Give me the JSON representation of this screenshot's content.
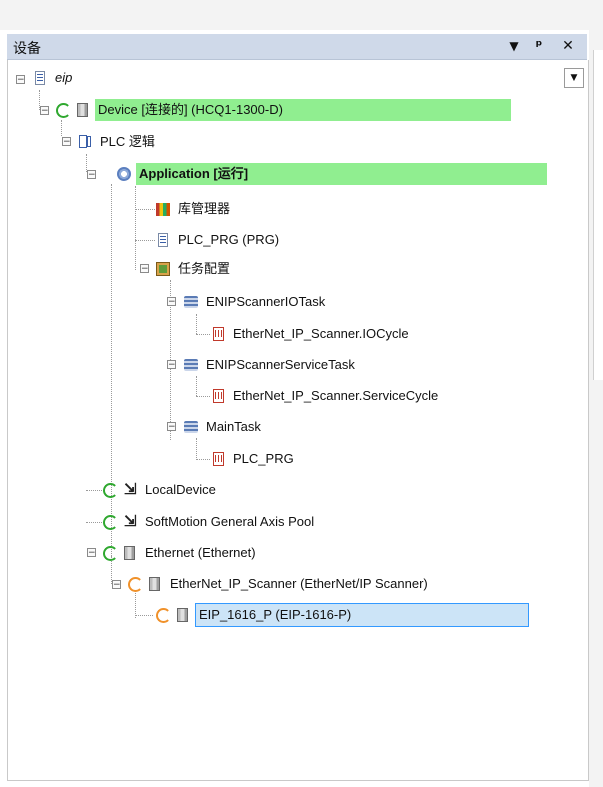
{
  "window": {
    "title": "设备"
  },
  "title_buttons": {
    "dropdown": "▼",
    "pin": "ᵖ",
    "close": "✕"
  },
  "tree": {
    "root": "eip",
    "device": "Device [连接的] (HCQ1-1300-D)",
    "plc_logic": "PLC 逻辑",
    "application": "Application [运行]",
    "library_manager": "库管理器",
    "plc_prg": "PLC_PRG (PRG)",
    "task_config": "任务配置",
    "enip_io_task": "ENIPScannerIOTask",
    "enip_io_cycle": "EtherNet_IP_Scanner.IOCycle",
    "enip_service_task": "ENIPScannerServiceTask",
    "enip_service_cycle": "EtherNet_IP_Scanner.ServiceCycle",
    "main_task": "MainTask",
    "main_task_prg": "PLC_PRG",
    "local_device": "LocalDevice",
    "softmotion": "SoftMotion General Axis Pool",
    "ethernet": "Ethernet (Ethernet)",
    "enip_scanner": "EtherNet_IP_Scanner (EtherNet/IP Scanner)",
    "eip_1616": "EIP_1616_P (EIP-1616-P)"
  },
  "colors": {
    "online_highlight": "#90ee90",
    "selection": "#cce4f7",
    "titlebar": "#cfd9e9"
  }
}
